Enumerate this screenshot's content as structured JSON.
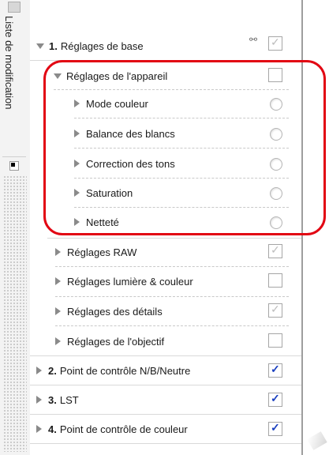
{
  "sidebar": {
    "vertical_label": "Liste de modification"
  },
  "sections": {
    "s1_number": "1.",
    "s1_label": "Réglages de base",
    "s1_appareil": "Réglages de l'appareil",
    "s1_mode": "Mode couleur",
    "s1_balance": "Balance des blancs",
    "s1_correction": "Correction des tons",
    "s1_saturation": "Saturation",
    "s1_nettete": "Netteté",
    "s1_raw": "Réglages RAW",
    "s1_lumiere": "Réglages lumière & couleur",
    "s1_details": "Réglages des détails",
    "s1_objectif": "Réglages de l'objectif",
    "s2_number": "2.",
    "s2_label": "Point de contrôle N/B/Neutre",
    "s3_number": "3.",
    "s3_label": "LST",
    "s4_number": "4.",
    "s4_label": "Point de contrôle de couleur"
  },
  "checks": {
    "mark": "✓"
  },
  "colors": {
    "highlight": "#e20613",
    "check_blue": "#1a3fbf",
    "check_grey": "#bdbdbd"
  },
  "icons": {
    "link": "link-icon",
    "expand": "triangle-right-icon",
    "collapse": "triangle-down-icon"
  }
}
